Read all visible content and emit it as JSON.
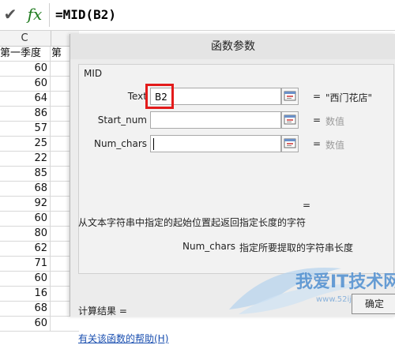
{
  "formula_bar": {
    "check_icon": "✔",
    "fx_label": "fx",
    "formula": "=MID(B2)"
  },
  "sheet": {
    "column_header": "C",
    "header_cell": "第一季度",
    "next_header_partial": "第",
    "values": [
      "60",
      "60",
      "64",
      "86",
      "57",
      "25",
      "22",
      "85",
      "68",
      "92",
      "60",
      "80",
      "62",
      "71",
      "60",
      "16",
      "68",
      "60"
    ]
  },
  "dialog": {
    "title": "函数参数",
    "function_name": "MID",
    "args": [
      {
        "label": "Text",
        "value": "B2",
        "result": "\"西门花店\""
      },
      {
        "label": "Start_num",
        "value": "",
        "result": "数值"
      },
      {
        "label": "Num_chars",
        "value": "",
        "result": "数值"
      }
    ],
    "equals": "=",
    "description": "从文本字符串中指定的起始位置起返回指定长度的字符",
    "arg_desc_name": "Num_chars",
    "arg_desc_text": "指定所要提取的字符串长度",
    "calc_label": "计算结果 =",
    "help_link": "有关该函数的帮助(H)",
    "ok_button": "确定"
  },
  "watermark": {
    "text": "我爱IT技术网",
    "url": "www.52ij.com"
  },
  "colors": {
    "highlight": "#e31b1b",
    "link": "#1a4fb0",
    "fx_green": "#1f7a1f"
  }
}
